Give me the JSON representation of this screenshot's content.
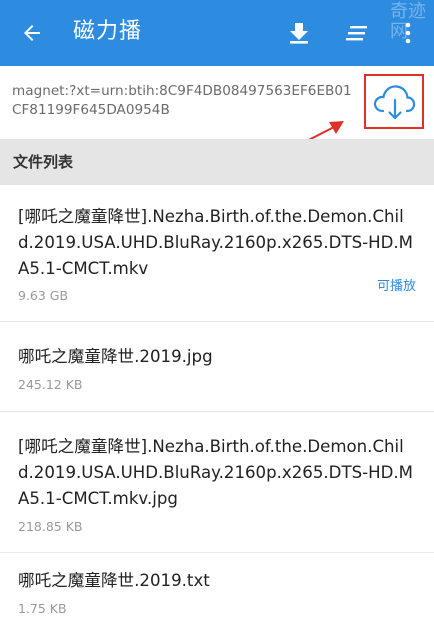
{
  "appbar": {
    "title": "磁力播",
    "back_icon": "back-arrow-icon",
    "download_icon": "download-icon",
    "sort_icon": "sort-icon",
    "more_icon": "more-vert-icon",
    "background_color": "#2d8be0"
  },
  "magnet": {
    "link": "magnet:?xt=urn:btih:8C9F4DB08497563EF6EB01CF81199F645DA0954B",
    "cloud_icon": "cloud-download-icon",
    "highlight_color": "#e0302a"
  },
  "section": {
    "title": "文件列表"
  },
  "files": [
    {
      "name": "[哪吒之魔童降世].Nezha.Birth.of.the.Demon.Child.2019.USA.UHD.BluRay.2160p.x265.DTS-HD.MA5.1-CMCT.mkv",
      "size": "9.63 GB",
      "badge": "可播放"
    },
    {
      "name": "哪吒之魔童降世.2019.jpg",
      "size": "245.12 KB"
    },
    {
      "name": "[哪吒之魔童降世].Nezha.Birth.of.the.Demon.Child.2019.USA.UHD.BluRay.2160p.x265.DTS-HD.MA5.1-CMCT.mkv.jpg",
      "size": "218.85 KB"
    },
    {
      "name": "哪吒之魔童降世.2019.txt",
      "size": "1.75 KB"
    }
  ],
  "watermark": "奇迹网"
}
